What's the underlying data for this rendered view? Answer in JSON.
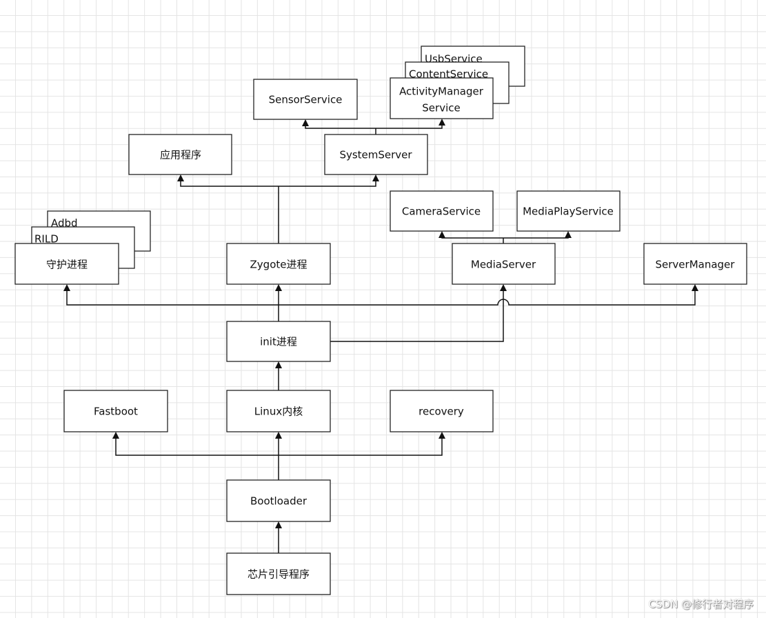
{
  "nodes": {
    "usb": "UsbService",
    "content": "ContentService",
    "ams_line1": "ActivityManager",
    "ams_line2": "Service",
    "sensor": "SensorService",
    "app": "应用程序",
    "systemserver": "SystemServer",
    "adbd": "Adbd",
    "rild": "RILD",
    "daemon": "守护进程",
    "zygote": "Zygote进程",
    "camera": "CameraService",
    "mediaplay": "MediaPlayService",
    "mediaserver": "MediaServer",
    "servermanager": "ServerManager",
    "init": "init进程",
    "fastboot": "Fastboot",
    "linux": "Linux内核",
    "recovery": "recovery",
    "bootloader": "Bootloader",
    "chip": "芯片引导程序"
  },
  "watermark": "CSDN @修行者对程序"
}
